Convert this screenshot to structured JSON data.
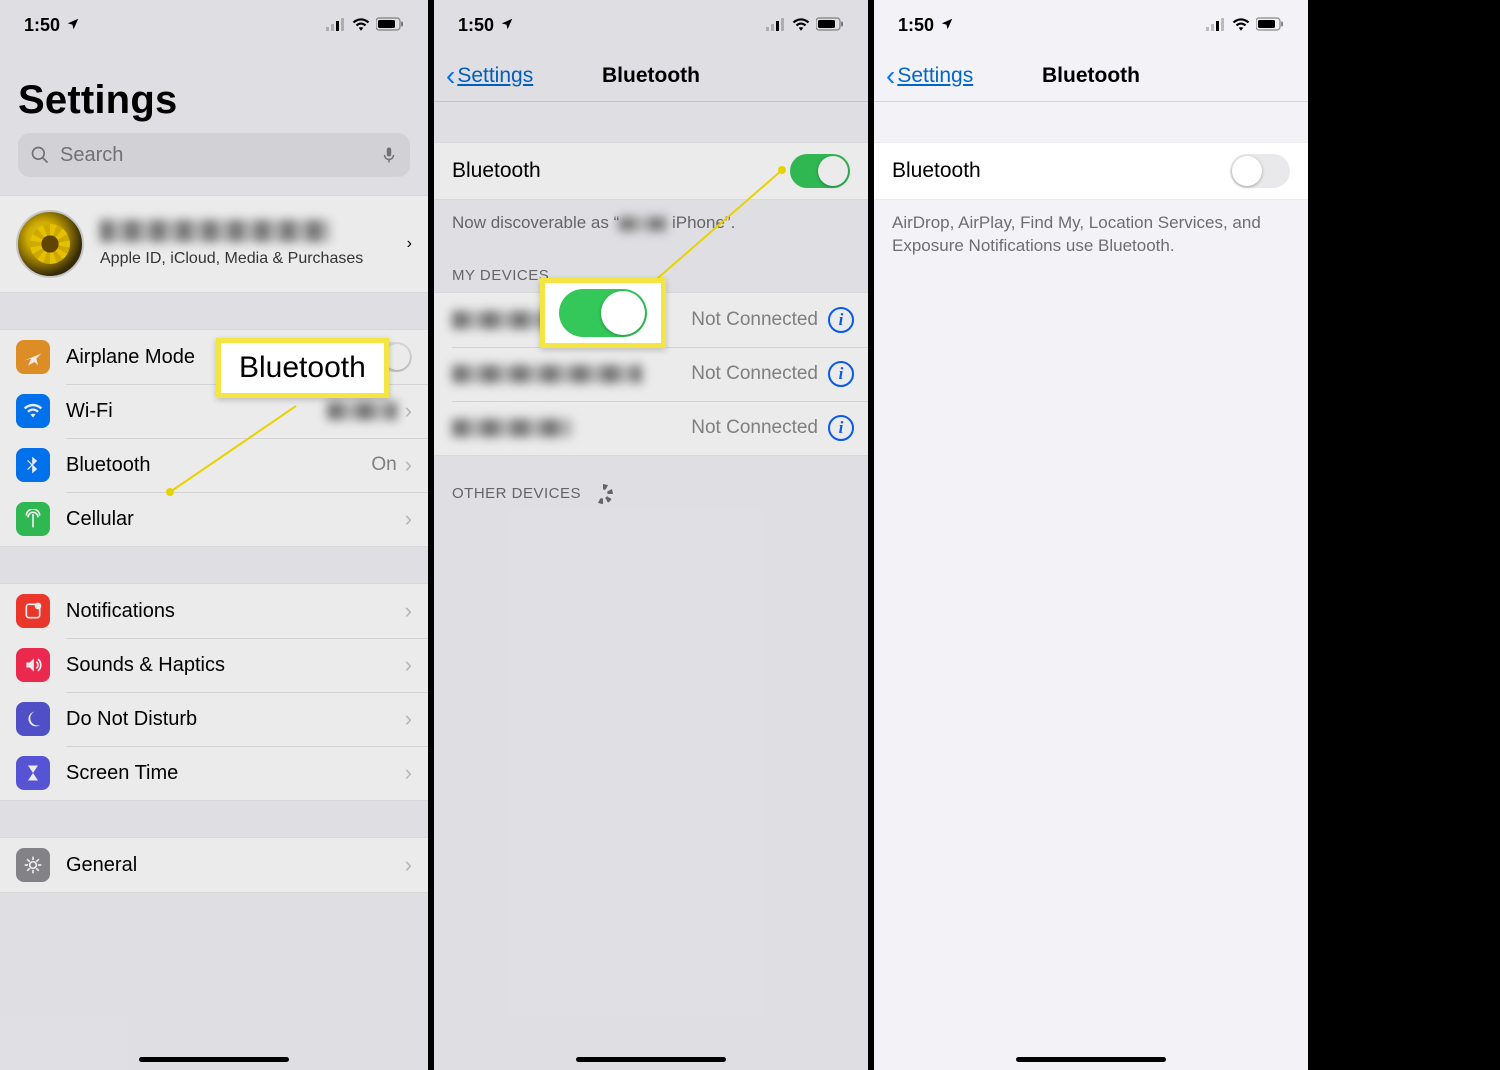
{
  "status": {
    "time": "1:50"
  },
  "left": {
    "title": "Settings",
    "search_placeholder": "Search",
    "profile_sub": "Apple ID, iCloud, Media & Purchases",
    "rows": {
      "airplane": "Airplane Mode",
      "wifi": "Wi-Fi",
      "bluetooth": "Bluetooth",
      "bluetooth_val": "On",
      "cellular": "Cellular",
      "notifications": "Notifications",
      "sounds": "Sounds & Haptics",
      "dnd": "Do Not Disturb",
      "screentime": "Screen Time",
      "general": "General"
    }
  },
  "mid": {
    "back": "Settings",
    "title": "Bluetooth",
    "bt_label": "Bluetooth",
    "discoverable_pre": "Now discoverable as “",
    "discoverable_post": "iPhone”.",
    "my_devices": "MY DEVICES",
    "other_devices": "OTHER DEVICES",
    "status_not_connected": "Not Connected"
  },
  "right": {
    "back": "Settings",
    "title": "Bluetooth",
    "bt_label": "Bluetooth",
    "helper": "AirDrop, AirPlay, Find My, Location Services, and Exposure Notifications use Bluetooth."
  },
  "callouts": {
    "bluetooth": "Bluetooth"
  }
}
